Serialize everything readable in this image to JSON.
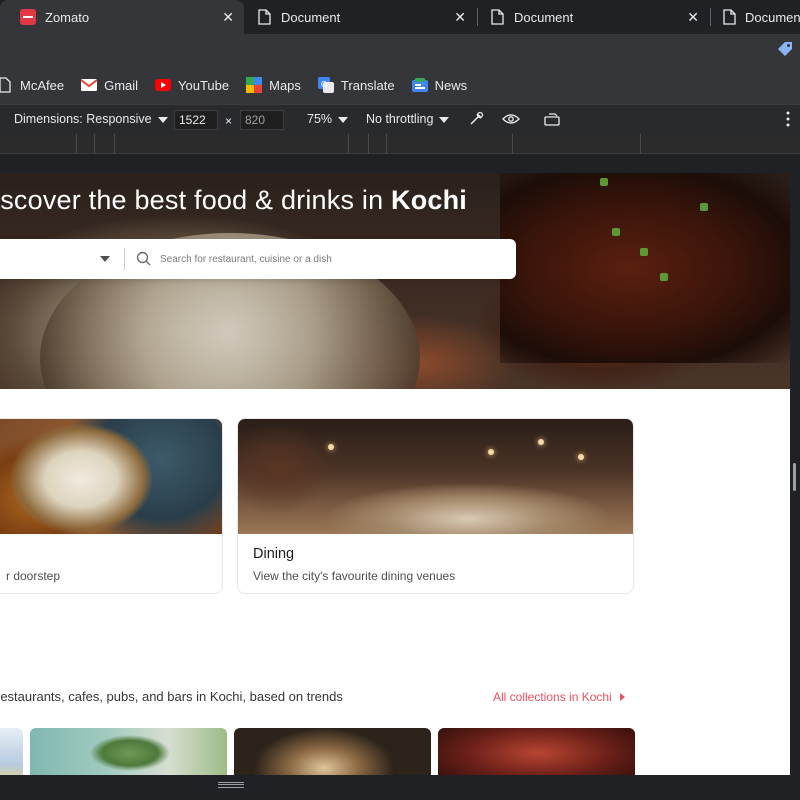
{
  "browser": {
    "tabs": [
      {
        "title": "Zomato",
        "active": true
      },
      {
        "title": "Document",
        "active": false
      },
      {
        "title": "Document",
        "active": false
      },
      {
        "title": "Document",
        "active": false
      }
    ],
    "bookmarks": [
      {
        "label": "McAfee",
        "icon": "page-icon"
      },
      {
        "label": "Gmail",
        "icon": "gmail-icon"
      },
      {
        "label": "YouTube",
        "icon": "youtube-icon"
      },
      {
        "label": "Maps",
        "icon": "maps-icon"
      },
      {
        "label": "Translate",
        "icon": "translate-icon"
      },
      {
        "label": "News",
        "icon": "news-icon"
      }
    ]
  },
  "devtools": {
    "dimensions_label": "Dimensions: Responsive",
    "width": "1522",
    "times": "×",
    "height": "820",
    "zoom": "75%",
    "throttling": "No throttling"
  },
  "page": {
    "hero": {
      "title_prefix": "iscover the best food & drinks in ",
      "city": "Kochi",
      "search_placeholder": "Search for restaurant, cuisine or a dish"
    },
    "cards": [
      {
        "title": "",
        "subtitle": "r doorstep"
      },
      {
        "title": "Dining",
        "subtitle": "View the city's favourite dining venues"
      }
    ],
    "collections": {
      "description": "restaurants, cafes, pubs, and bars in Kochi, based on trends",
      "link": "All collections in Kochi"
    }
  },
  "colors": {
    "brand": "#ef4f5f",
    "chrome_dark": "#202124",
    "chrome_mid": "#35363a"
  }
}
